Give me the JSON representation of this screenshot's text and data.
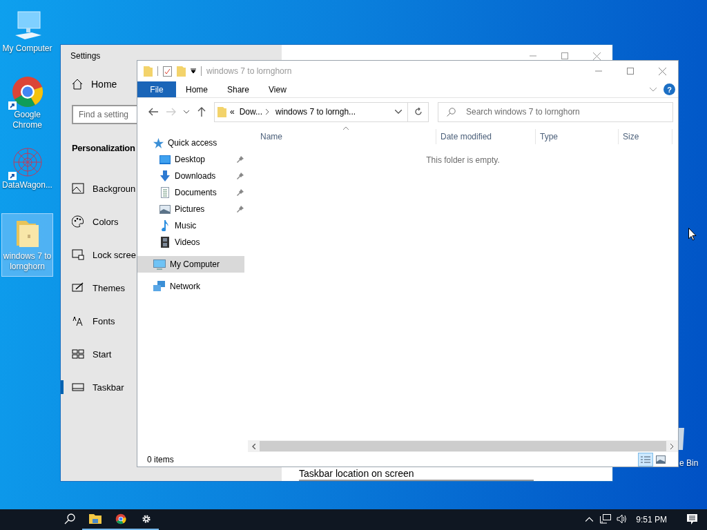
{
  "desktop": {
    "icons": [
      {
        "label": "My Computer",
        "kind": "computer",
        "shortcut": false,
        "selected": false
      },
      {
        "label": "Google Chrome",
        "kind": "browser",
        "shortcut": true,
        "selected": false
      },
      {
        "label": "DataWagon...",
        "kind": "app",
        "shortcut": true,
        "selected": false
      },
      {
        "label": "windows 7 to lornghorn",
        "kind": "folder",
        "shortcut": false,
        "selected": true
      }
    ],
    "recycle_bin": {
      "label": "e Bin"
    }
  },
  "settings": {
    "title": "Settings",
    "home": "Home",
    "search": {
      "placeholder": "Find a setting"
    },
    "section": "Personalization",
    "nav": [
      {
        "label": "Backgroun",
        "selected": false
      },
      {
        "label": "Colors",
        "selected": false
      },
      {
        "label": "Lock scree",
        "selected": false
      },
      {
        "label": "Themes",
        "selected": false
      },
      {
        "label": "Fonts",
        "selected": false
      },
      {
        "label": "Start",
        "selected": false
      },
      {
        "label": "Taskbar",
        "selected": true
      }
    ],
    "content_label": "Taskbar location on screen"
  },
  "explorer": {
    "title": "windows 7 to lornghorn",
    "ribbon_tabs": [
      {
        "label": "File",
        "kind": "menu"
      },
      {
        "label": "Home",
        "kind": "tab"
      },
      {
        "label": "Share",
        "kind": "tab"
      },
      {
        "label": "View",
        "kind": "tab"
      }
    ],
    "help": "?",
    "navigation": {
      "back_disabled": false,
      "forward_disabled": true
    },
    "address": {
      "overflow": "«",
      "segments": [
        "Dow...",
        "windows 7 to lorngh..."
      ]
    },
    "search": {
      "placeholder": "Search windows 7 to lornghorn"
    },
    "nav": [
      {
        "label": "Quick access",
        "kind": "quick",
        "selected": false,
        "children": [
          {
            "label": "Desktop",
            "kind": "desktop",
            "pinned": true
          },
          {
            "label": "Downloads",
            "kind": "downloads",
            "pinned": true
          },
          {
            "label": "Documents",
            "kind": "documents",
            "pinned": true
          },
          {
            "label": "Pictures",
            "kind": "pictures",
            "pinned": true
          },
          {
            "label": "Music",
            "kind": "music",
            "pinned": false
          },
          {
            "label": "Videos",
            "kind": "videos",
            "pinned": false
          }
        ]
      },
      {
        "label": "My Computer",
        "kind": "computer",
        "selected": true
      },
      {
        "label": "Network",
        "kind": "network",
        "selected": false
      }
    ],
    "columns": [
      {
        "label": "Name",
        "sorted": true
      },
      {
        "label": "Date modified",
        "sorted": false
      },
      {
        "label": "Type",
        "sorted": false
      },
      {
        "label": "Size",
        "sorted": false
      }
    ],
    "empty_message": "This folder is empty.",
    "status": "0 items",
    "views": [
      {
        "selected": true
      },
      {
        "selected": false
      }
    ]
  },
  "taskbar": {
    "apps": [
      {
        "kind": "explorer",
        "running": true
      },
      {
        "kind": "chrome",
        "running": true
      },
      {
        "kind": "settings",
        "running": true
      }
    ],
    "clock": "9:51 PM"
  }
}
